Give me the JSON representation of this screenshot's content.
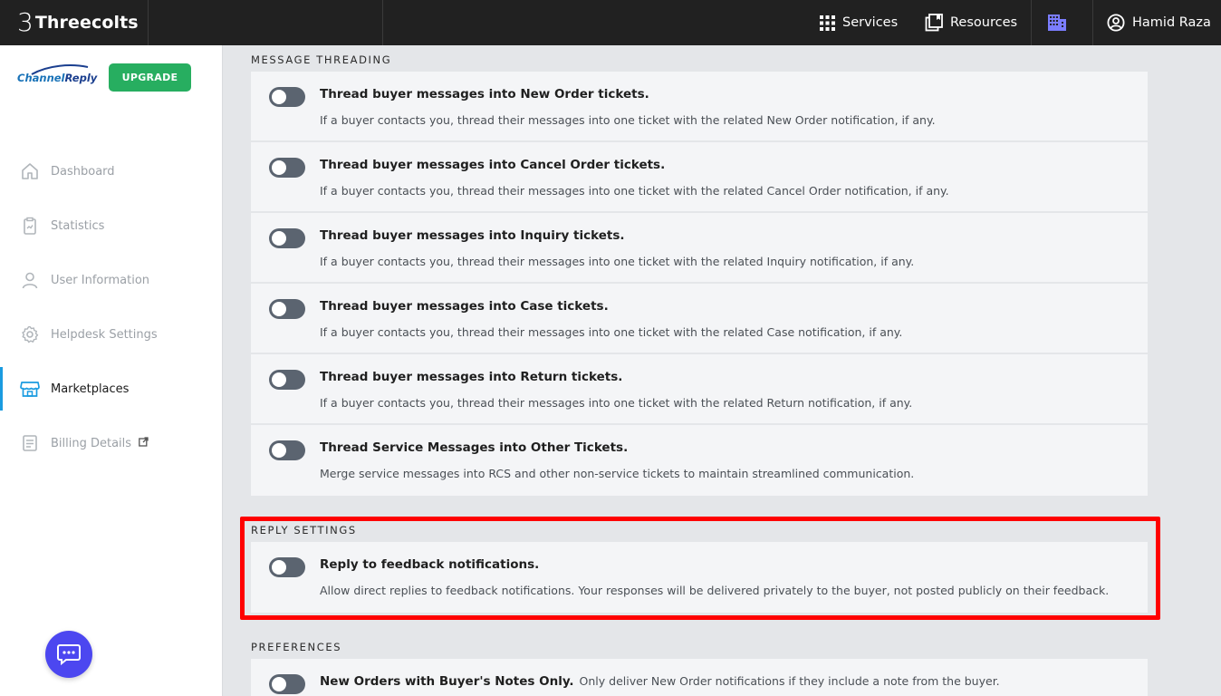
{
  "topbar": {
    "brand_mark": "3",
    "brand_name": "Threecolts",
    "services_label": "Services",
    "resources_label": "Resources",
    "user_name": "Hamid Raza"
  },
  "sidebar": {
    "logo_channel": "Channel",
    "logo_reply": "Reply",
    "upgrade_label": "UPGRADE",
    "items": [
      {
        "label": "Dashboard",
        "icon": "home-icon"
      },
      {
        "label": "Statistics",
        "icon": "clipboard-icon"
      },
      {
        "label": "User Information",
        "icon": "user-icon"
      },
      {
        "label": "Helpdesk Settings",
        "icon": "gear-icon"
      },
      {
        "label": "Marketplaces",
        "icon": "store-icon",
        "active": true
      },
      {
        "label": "Billing Details",
        "icon": "receipt-icon"
      }
    ]
  },
  "message_threading": {
    "title": "MESSAGE THREADING",
    "items": [
      {
        "title": "Thread buyer messages into New Order tickets.",
        "desc": "If a buyer contacts you, thread their messages into one ticket with the related New Order notification, if any.",
        "enabled": false
      },
      {
        "title": "Thread buyer messages into Cancel Order tickets.",
        "desc": "If a buyer contacts you, thread their messages into one ticket with the related Cancel Order notification, if any.",
        "enabled": false
      },
      {
        "title": "Thread buyer messages into Inquiry tickets.",
        "desc": "If a buyer contacts you, thread their messages into one ticket with the related Inquiry notification, if any.",
        "enabled": false
      },
      {
        "title": "Thread buyer messages into Case tickets.",
        "desc": "If a buyer contacts you, thread their messages into one ticket with the related Case notification, if any.",
        "enabled": false
      },
      {
        "title": "Thread buyer messages into Return tickets.",
        "desc": "If a buyer contacts you, thread their messages into one ticket with the related Return notification, if any.",
        "enabled": false
      },
      {
        "title": "Thread Service Messages into Other Tickets.",
        "desc": "Merge service messages into RCS and other non-service tickets to maintain streamlined communication.",
        "enabled": false
      }
    ]
  },
  "reply_settings": {
    "title": "REPLY SETTINGS",
    "items": [
      {
        "title": "Reply to feedback notifications.",
        "desc": "Allow direct replies to feedback notifications. Your responses will be delivered privately to the buyer, not posted publicly on their feedback.",
        "enabled": false
      }
    ]
  },
  "preferences": {
    "title": "PREFERENCES",
    "items": [
      {
        "title": "New Orders with Buyer's Notes Only.",
        "desc": "Only deliver New Order notifications if they include a note from the buyer.",
        "enabled": false
      }
    ]
  },
  "colors": {
    "topbar": "#212121",
    "upgrade": "#27ae60",
    "active_accent": "#1a9be0",
    "highlight": "#ff0000",
    "chat": "#4c47f0"
  }
}
